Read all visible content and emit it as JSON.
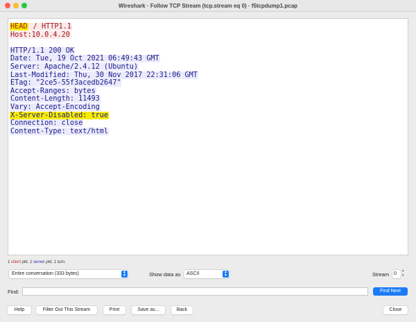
{
  "window": {
    "title": "Wireshark · Follow TCP Stream (tcp.stream eq 0) · f5tcpdump1.pcap"
  },
  "stream_lines": [
    {
      "side": "client",
      "parts": [
        {
          "text": "HEAD",
          "highlight": true
        },
        {
          "text": " / HTTP1.1",
          "highlight": false
        }
      ]
    },
    {
      "side": "client",
      "parts": [
        {
          "text": "Host:10.0.4.20",
          "highlight": false
        }
      ]
    },
    {
      "side": "blank",
      "parts": []
    },
    {
      "side": "server",
      "parts": [
        {
          "text": "HTTP/1.1 200 OK",
          "highlight": false
        }
      ]
    },
    {
      "side": "server",
      "parts": [
        {
          "text": "Date: Tue, 19 Oct 2021 06:49:43 GMT",
          "highlight": false
        }
      ]
    },
    {
      "side": "server",
      "parts": [
        {
          "text": "Server: Apache/2.4.12 (Ubuntu)",
          "highlight": false
        }
      ]
    },
    {
      "side": "server",
      "parts": [
        {
          "text": "Last-Modified: Thu, 30 Nov 2017 22:31:06 GMT",
          "highlight": false
        }
      ]
    },
    {
      "side": "server",
      "parts": [
        {
          "text": "ETag: \"2ce5-55f3acedb2647\"",
          "highlight": false
        }
      ]
    },
    {
      "side": "server",
      "parts": [
        {
          "text": "Accept-Ranges: bytes",
          "highlight": false
        }
      ]
    },
    {
      "side": "server",
      "parts": [
        {
          "text": "Content-Length: 11493",
          "highlight": false
        }
      ]
    },
    {
      "side": "server",
      "parts": [
        {
          "text": "Vary: Accept-Encoding",
          "highlight": false
        }
      ]
    },
    {
      "side": "server",
      "parts": [
        {
          "text": "X-Server-Disabled: true",
          "highlight": true
        }
      ]
    },
    {
      "side": "server",
      "parts": [
        {
          "text": "Connection: close",
          "highlight": false
        }
      ]
    },
    {
      "side": "server",
      "parts": [
        {
          "text": "Content-Type: text/html",
          "highlight": false
        }
      ]
    }
  ],
  "status": {
    "n1": "1",
    "client": "client",
    "mid": " pkt, 1 ",
    "server": "server",
    "end": " pkt, 1 turn."
  },
  "controls": {
    "conversation": "Entire conversation (333 bytes)",
    "show_data_label": "Show data as",
    "show_data_value": "ASCII",
    "stream_label": "Stream",
    "stream_value": "0",
    "find_label": "Find:",
    "find_value": "",
    "find_next": "Find Next"
  },
  "buttons": {
    "help": "Help",
    "filter_out": "Filter Out This Stream",
    "print": "Print",
    "save_as": "Save as...",
    "back": "Back",
    "close": "Close"
  },
  "colors": {
    "accent": "#1a7cf5",
    "client": "#a0141e",
    "server": "#1a1a8a",
    "highlight": "#f7eb00"
  }
}
